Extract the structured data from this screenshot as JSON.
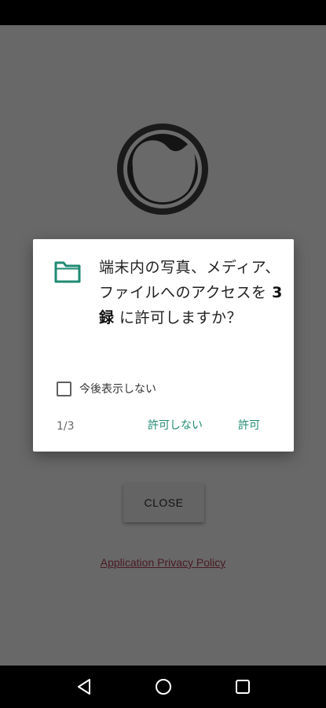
{
  "app": {
    "close_label": "CLOSE",
    "privacy_link": "Application Privacy Policy"
  },
  "dialog": {
    "message_before": "端末内の写真、メディア、ファイルへのアクセスを ",
    "app_name": "3録",
    "message_after": " に許可しますか？",
    "dont_ask_label": "今後表示しない",
    "dont_ask_checked": false,
    "counter": "1/3",
    "deny_label": "許可しない",
    "allow_label": "許可"
  },
  "icons": {
    "logo": "app-logo-icon",
    "folder": "folder-icon",
    "nav_back": "back-icon",
    "nav_home": "home-icon",
    "nav_recents": "recents-icon"
  },
  "colors": {
    "accent": "#1f8a73",
    "scrim": "#686868",
    "link": "#4a1a24"
  }
}
